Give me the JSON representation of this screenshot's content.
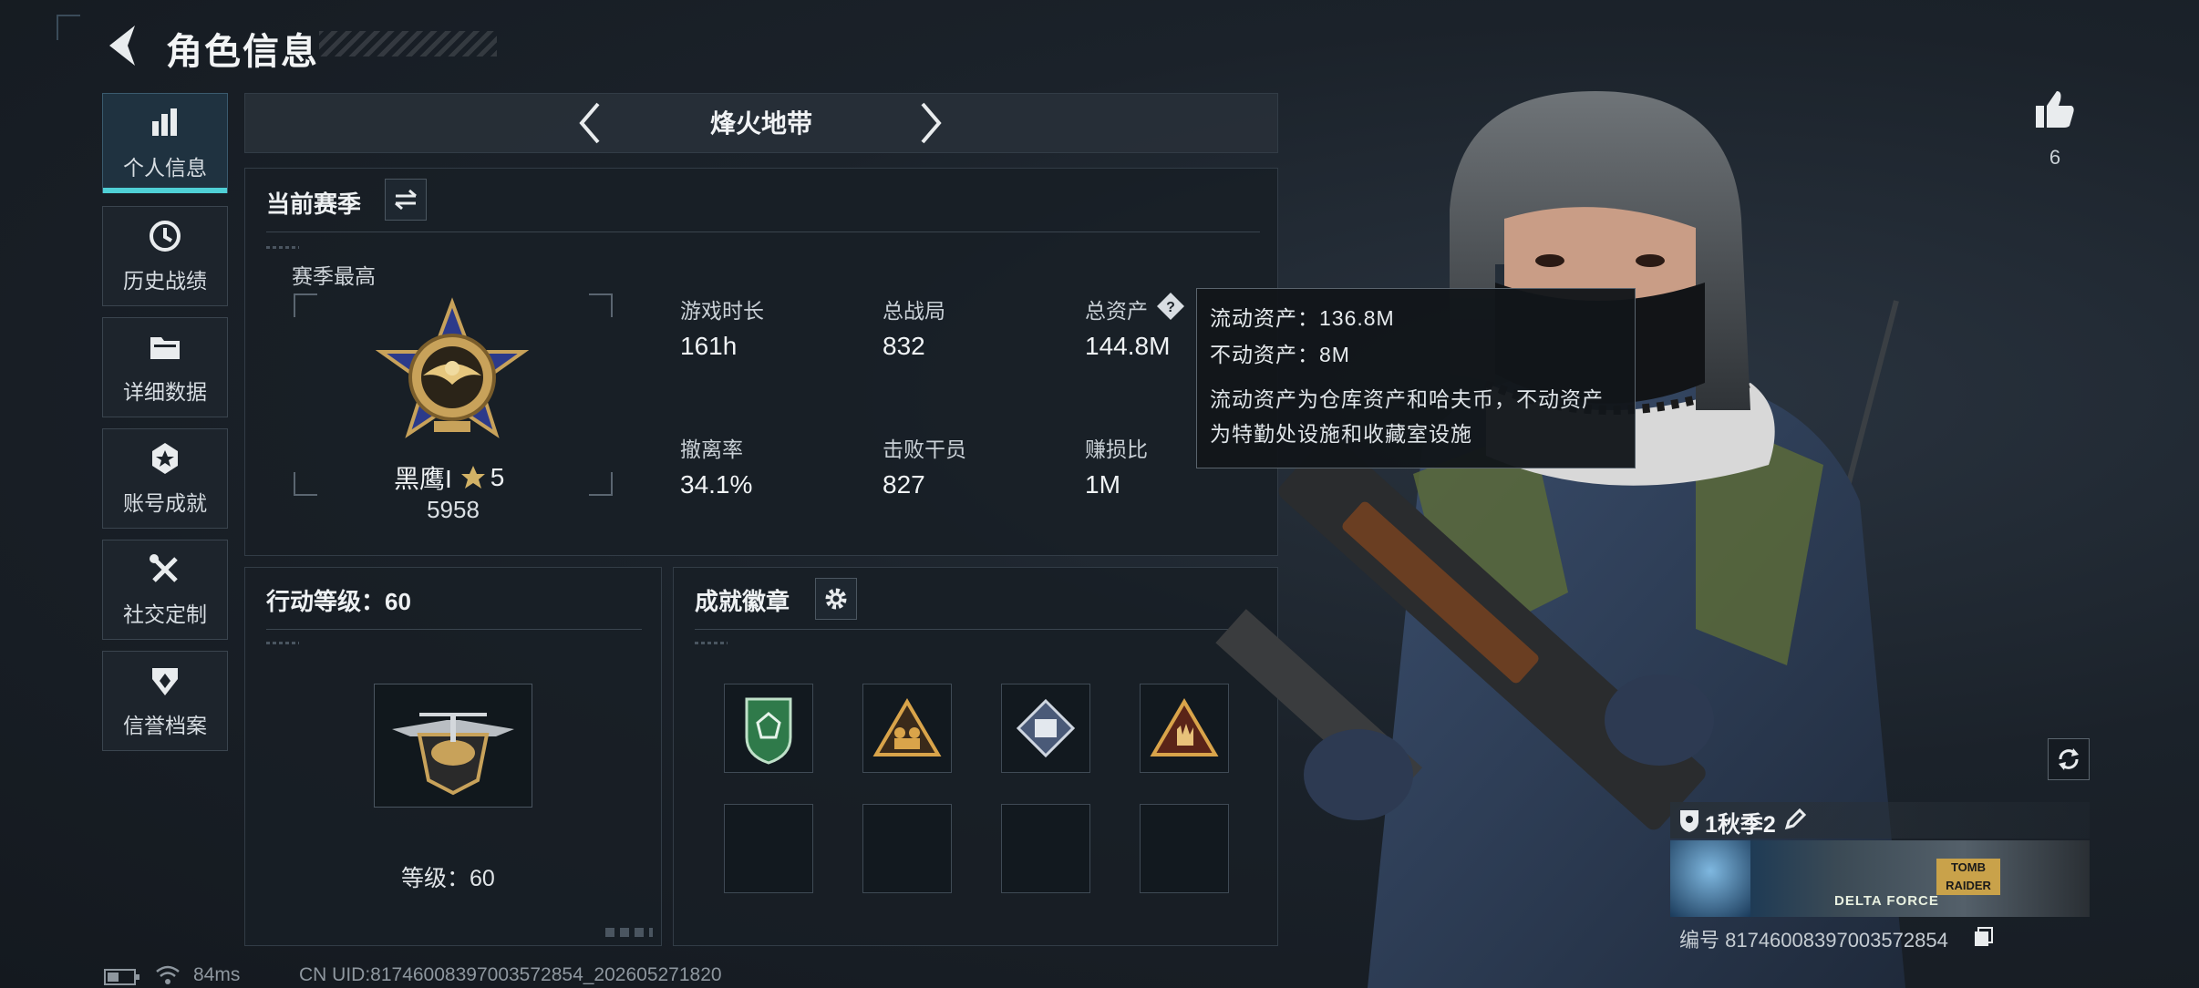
{
  "header": {
    "title": "角色信息"
  },
  "sidebar": {
    "items": [
      {
        "label": "个人信息",
        "active": true,
        "icon": "bar-chart-icon"
      },
      {
        "label": "历史战绩",
        "active": false,
        "icon": "history-icon"
      },
      {
        "label": "详细数据",
        "active": false,
        "icon": "folder-icon"
      },
      {
        "label": "账号成就",
        "active": false,
        "icon": "achievement-icon"
      },
      {
        "label": "社交定制",
        "active": false,
        "icon": "tools-icon"
      },
      {
        "label": "信誉档案",
        "active": false,
        "icon": "shield-icon"
      }
    ]
  },
  "mode_selector": {
    "label": "烽火地带"
  },
  "season_panel": {
    "title": "当前赛季",
    "season_best_label": "赛季最高",
    "rank_name": "黑鹰I",
    "rank_stars": "5",
    "rank_score": "5958",
    "stats": [
      {
        "label": "游戏时长",
        "value": "161h"
      },
      {
        "label": "总战局",
        "value": "832"
      },
      {
        "label": "总资产",
        "value": "144.8M"
      },
      {
        "label": "撤离率",
        "value": "34.1%"
      },
      {
        "label": "击败干员",
        "value": "827"
      },
      {
        "label": "赚损比",
        "value": "1M"
      }
    ]
  },
  "tooltip": {
    "liquid": "流动资产：136.8M",
    "fixed": "不动资产：8M",
    "desc_line1": "流动资产为仓库资产和哈夫币，不动资产",
    "desc_line2": "为特勤处设施和收藏室设施"
  },
  "action_panel": {
    "title": "行动等级：60",
    "level_text": "等级：60"
  },
  "badge_panel": {
    "title": "成就徽章"
  },
  "likes": {
    "count": "6"
  },
  "profile_card": {
    "name": "1秋季2",
    "id_text": "编号 81746008397003572854",
    "banner_texts": [
      "DELTA FORCE",
      "TOMB RAIDER"
    ]
  },
  "status_bar": {
    "ping": "84ms",
    "uid": "CN UID:81746008397003572854_202605271820"
  },
  "colors": {
    "accent": "#4fd0d6",
    "gold": "#c8a25a",
    "panel": "#181f26"
  }
}
